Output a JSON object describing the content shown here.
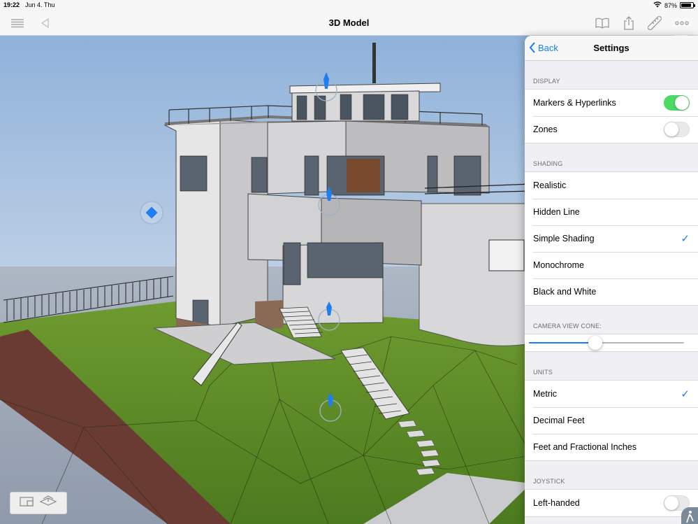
{
  "status": {
    "time": "19:22",
    "date": "Jun 4. Thu",
    "battery": "87%",
    "battery_level": 0.87
  },
  "nav": {
    "title": "3D Model",
    "icons": [
      "list-icon",
      "back-triangle-icon",
      "book-icon",
      "share-icon",
      "ruler-icon",
      "more-icon"
    ]
  },
  "settings": {
    "back_label": "Back",
    "title": "Settings",
    "display": {
      "header": "DISPLAY",
      "rows": [
        {
          "label": "Markers & Hyperlinks",
          "toggle": true
        },
        {
          "label": "Zones",
          "toggle": false
        }
      ]
    },
    "shading": {
      "header": "SHADING",
      "options": [
        "Realistic",
        "Hidden Line",
        "Simple Shading",
        "Monochrome",
        "Black and White"
      ],
      "selected": "Simple Shading"
    },
    "camera": {
      "header": "CAMERA VIEW CONE:",
      "value": 0.43
    },
    "units": {
      "header": "UNITS",
      "options": [
        "Metric",
        "Decimal Feet",
        "Feet and Fractional Inches"
      ],
      "selected": "Metric"
    },
    "joystick": {
      "header": "JOYSTICK",
      "rows": [
        {
          "label": "Left-handed",
          "toggle": false
        }
      ]
    }
  },
  "colors": {
    "accent": "#147efb",
    "toggle_on": "#4cd964",
    "marker": "#1f7ef0"
  },
  "toolbar": {
    "icons": [
      "plan-view-icon",
      "3d-view-icon"
    ]
  }
}
